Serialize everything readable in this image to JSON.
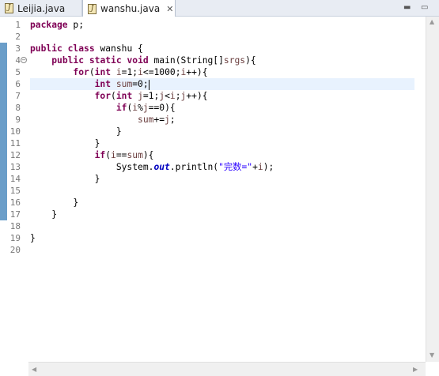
{
  "tabs": [
    {
      "label": "Leijia.java",
      "icon": "java-file-icon",
      "active": false
    },
    {
      "label": "wanshu.java",
      "icon": "java-file-icon",
      "active": true,
      "close": "✕"
    }
  ],
  "window_controls": {
    "minimize": "▬",
    "maximize": "▭"
  },
  "editor": {
    "line_numbers": [
      "1",
      "2",
      "3",
      "4",
      "5",
      "6",
      "7",
      "8",
      "9",
      "10",
      "11",
      "12",
      "13",
      "14",
      "15",
      "16",
      "17",
      "18",
      "19",
      "20"
    ],
    "lines": [
      [
        {
          "t": "package",
          "c": "kw"
        },
        {
          "t": " p;",
          "c": ""
        }
      ],
      [],
      [
        {
          "t": "public",
          "c": "kw"
        },
        {
          "t": " ",
          "c": ""
        },
        {
          "t": "class",
          "c": "kw"
        },
        {
          "t": " wanshu {",
          "c": ""
        }
      ],
      [
        {
          "t": "    ",
          "c": ""
        },
        {
          "t": "public",
          "c": "kw"
        },
        {
          "t": " ",
          "c": ""
        },
        {
          "t": "static",
          "c": "kw"
        },
        {
          "t": " ",
          "c": ""
        },
        {
          "t": "void",
          "c": "kw"
        },
        {
          "t": " main(String[]",
          "c": ""
        },
        {
          "t": "srgs",
          "c": "var"
        },
        {
          "t": "){",
          "c": ""
        }
      ],
      [
        {
          "t": "        ",
          "c": ""
        },
        {
          "t": "for",
          "c": "kw"
        },
        {
          "t": "(",
          "c": ""
        },
        {
          "t": "int",
          "c": "kw"
        },
        {
          "t": " ",
          "c": ""
        },
        {
          "t": "i",
          "c": "var"
        },
        {
          "t": "=1;",
          "c": ""
        },
        {
          "t": "i",
          "c": "var"
        },
        {
          "t": "<=1000;",
          "c": ""
        },
        {
          "t": "i",
          "c": "var"
        },
        {
          "t": "++){",
          "c": ""
        }
      ],
      [
        {
          "t": "            ",
          "c": ""
        },
        {
          "t": "int",
          "c": "kw"
        },
        {
          "t": " ",
          "c": ""
        },
        {
          "t": "sum",
          "c": "var"
        },
        {
          "t": "=0;",
          "c": ""
        }
      ],
      [
        {
          "t": "            ",
          "c": ""
        },
        {
          "t": "for",
          "c": "kw"
        },
        {
          "t": "(",
          "c": ""
        },
        {
          "t": "int",
          "c": "kw"
        },
        {
          "t": " ",
          "c": ""
        },
        {
          "t": "j",
          "c": "var"
        },
        {
          "t": "=1;",
          "c": ""
        },
        {
          "t": "j",
          "c": "var"
        },
        {
          "t": "<",
          "c": ""
        },
        {
          "t": "i",
          "c": "var"
        },
        {
          "t": ";",
          "c": ""
        },
        {
          "t": "j",
          "c": "var"
        },
        {
          "t": "++){",
          "c": ""
        }
      ],
      [
        {
          "t": "                ",
          "c": ""
        },
        {
          "t": "if",
          "c": "kw"
        },
        {
          "t": "(",
          "c": ""
        },
        {
          "t": "i",
          "c": "var"
        },
        {
          "t": "%",
          "c": ""
        },
        {
          "t": "j",
          "c": "var"
        },
        {
          "t": "==0){",
          "c": ""
        }
      ],
      [
        {
          "t": "                    ",
          "c": ""
        },
        {
          "t": "sum",
          "c": "var"
        },
        {
          "t": "+=",
          "c": ""
        },
        {
          "t": "j",
          "c": "var"
        },
        {
          "t": ";",
          "c": ""
        }
      ],
      [
        {
          "t": "                }",
          "c": ""
        }
      ],
      [
        {
          "t": "            }",
          "c": ""
        }
      ],
      [
        {
          "t": "            ",
          "c": ""
        },
        {
          "t": "if",
          "c": "kw"
        },
        {
          "t": "(",
          "c": ""
        },
        {
          "t": "i",
          "c": "var"
        },
        {
          "t": "==",
          "c": ""
        },
        {
          "t": "sum",
          "c": "var"
        },
        {
          "t": "){",
          "c": ""
        }
      ],
      [
        {
          "t": "                System.",
          "c": ""
        },
        {
          "t": "out",
          "c": "fld"
        },
        {
          "t": ".println(",
          "c": ""
        },
        {
          "t": "\"完数=\"",
          "c": "str"
        },
        {
          "t": "+",
          "c": ""
        },
        {
          "t": "i",
          "c": "var"
        },
        {
          "t": ");",
          "c": ""
        }
      ],
      [
        {
          "t": "            }",
          "c": ""
        }
      ],
      [],
      [
        {
          "t": "        }",
          "c": ""
        }
      ],
      [
        {
          "t": "    }",
          "c": ""
        }
      ],
      [],
      [
        {
          "t": "}",
          "c": ""
        }
      ],
      []
    ],
    "current_line": 6,
    "fold_marker_line": 4,
    "modified_lines": [
      3,
      4,
      5,
      6,
      7,
      8,
      9,
      10,
      11,
      12,
      13,
      14,
      15,
      16,
      17
    ]
  },
  "colors": {
    "keyword": "#7f0055",
    "variable": "#6a3e3e",
    "field": "#0000c0",
    "string": "#2a00ff",
    "current_line_bg": "#e8f2fe",
    "change_bar": "#6b9ec9"
  }
}
